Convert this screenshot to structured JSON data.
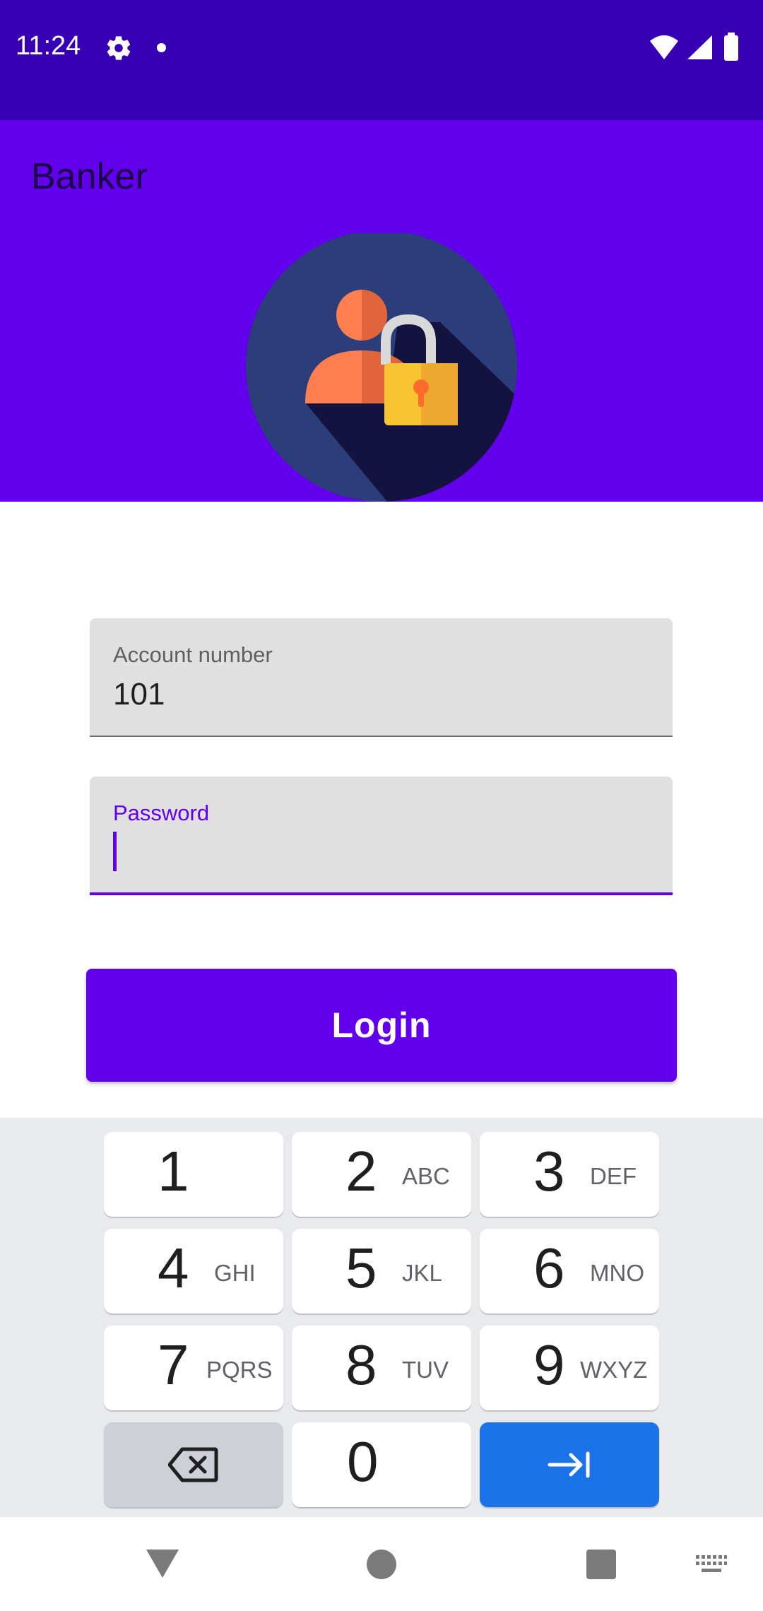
{
  "status_bar": {
    "time": "11:24",
    "icons": [
      "gear-icon",
      "dot-icon",
      "wifi-icon",
      "signal-icon",
      "battery-icon"
    ]
  },
  "app_bar": {
    "title": "Banker"
  },
  "header": {
    "logo": "user-lock-avatar",
    "colors": {
      "background": "#6200ee",
      "circle": "#2c3e7a"
    }
  },
  "form": {
    "account": {
      "label": "Account number",
      "value": "101"
    },
    "password": {
      "label": "Password",
      "value": ""
    },
    "login_label": "Login"
  },
  "keyboard": {
    "keys": [
      {
        "num": "1",
        "letters": ""
      },
      {
        "num": "2",
        "letters": "ABC"
      },
      {
        "num": "3",
        "letters": "DEF"
      },
      {
        "num": "4",
        "letters": "GHI"
      },
      {
        "num": "5",
        "letters": "JKL"
      },
      {
        "num": "6",
        "letters": "MNO"
      },
      {
        "num": "7",
        "letters": "PQRS"
      },
      {
        "num": "8",
        "letters": "TUV"
      },
      {
        "num": "9",
        "letters": "WXYZ"
      },
      {
        "num": "0",
        "letters": ""
      }
    ],
    "delete_icon": "backspace-icon",
    "next_icon": "tab-next-icon"
  },
  "nav_bar": {
    "icons": [
      "back-icon",
      "home-icon",
      "recents-icon",
      "keyboard-icon"
    ]
  },
  "colors": {
    "primary": "#6200ee",
    "primary_dark": "#3700b3",
    "key_accent": "#1a73e8"
  }
}
